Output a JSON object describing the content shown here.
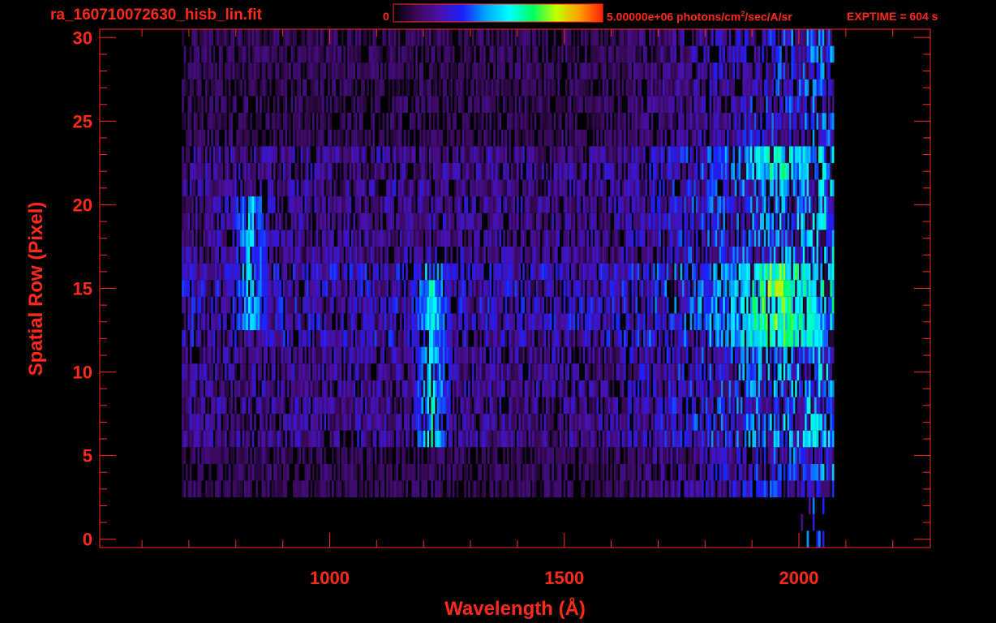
{
  "header": {
    "filename": "ra_160710072630_hisb_lin.fit",
    "colorbar_min": "0",
    "colorbar_max_prefix": "5.00000e+06 photons/cm",
    "colorbar_max_sup": "2",
    "colorbar_max_suffix": "/sec/A/sr",
    "exptime": "EXPTIME = 604 s"
  },
  "colors": {
    "axis": "#ff2a1a",
    "background": "#000000",
    "colormap": [
      "#000000",
      "#3a0a5a",
      "#4a10a8",
      "#1a20ff",
      "#00aaff",
      "#00ffff",
      "#00ff60",
      "#c0ff00",
      "#ffa000",
      "#ff2000"
    ]
  },
  "chart_data": {
    "type": "heatmap",
    "xlabel": "Wavelength (Å)",
    "ylabel": "Spatial Row (Pixel)",
    "xlim": [
      510,
      2280
    ],
    "ylim": [
      -0.5,
      30.5
    ],
    "x_ticks": [
      1000,
      1500,
      2000
    ],
    "x_tick_labels": [
      "1000",
      "1500",
      "2000"
    ],
    "x_minor_step": 100,
    "y_ticks": [
      0,
      5,
      10,
      15,
      20,
      25,
      30
    ],
    "y_tick_labels": [
      "0",
      "5",
      "10",
      "15",
      "20",
      "25",
      "30"
    ],
    "y_minor_step": 1,
    "colorbar_range": [
      0,
      5000000
    ],
    "colorbar_unit": "photons/cm^2/sec/A/sr",
    "data_extent_x": [
      685,
      2075
    ],
    "rows": 31,
    "features": [
      {
        "wavelength": 1216,
        "rows": [
          6,
          16
        ],
        "level": 0.55
      },
      {
        "wavelength": 830,
        "rows": [
          13,
          20
        ],
        "level": 0.5
      },
      {
        "wavelength": 1950,
        "rows": [
          12,
          16
        ],
        "level": 0.7
      },
      {
        "wavelength": 1950,
        "rows": [
          22,
          23
        ],
        "level": 0.6
      }
    ]
  }
}
